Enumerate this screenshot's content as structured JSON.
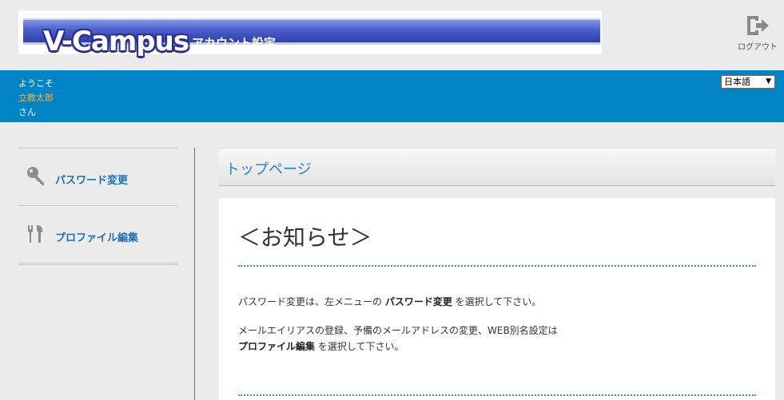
{
  "header": {
    "brand": "V-Campus",
    "subtitle": "アカウント設定",
    "logout_label": "ログアウト",
    "logout_icon": "logout-icon"
  },
  "band": {
    "welcome": "ようこそ",
    "user_name": "立教太郎",
    "honorific": "さん",
    "language": "日本語"
  },
  "sidebar": {
    "items": [
      {
        "label": "パスワード変更",
        "icon": "key-icon"
      },
      {
        "label": "プロファイル編集",
        "icon": "tools-icon"
      }
    ]
  },
  "main": {
    "page_title": "トップページ",
    "notice_title": "＜お知らせ＞",
    "line1_pre": "パスワード変更は、左メニューの ",
    "line1_bold": "パスワード変更",
    "line1_post": " を選択して下さい。",
    "line2": "メールエイリアスの登録、予備のメールアドレスの変更、WEB別名設定は",
    "line3_bold": "プロファイル編集",
    "line3_post": " を選択して下さい。"
  }
}
